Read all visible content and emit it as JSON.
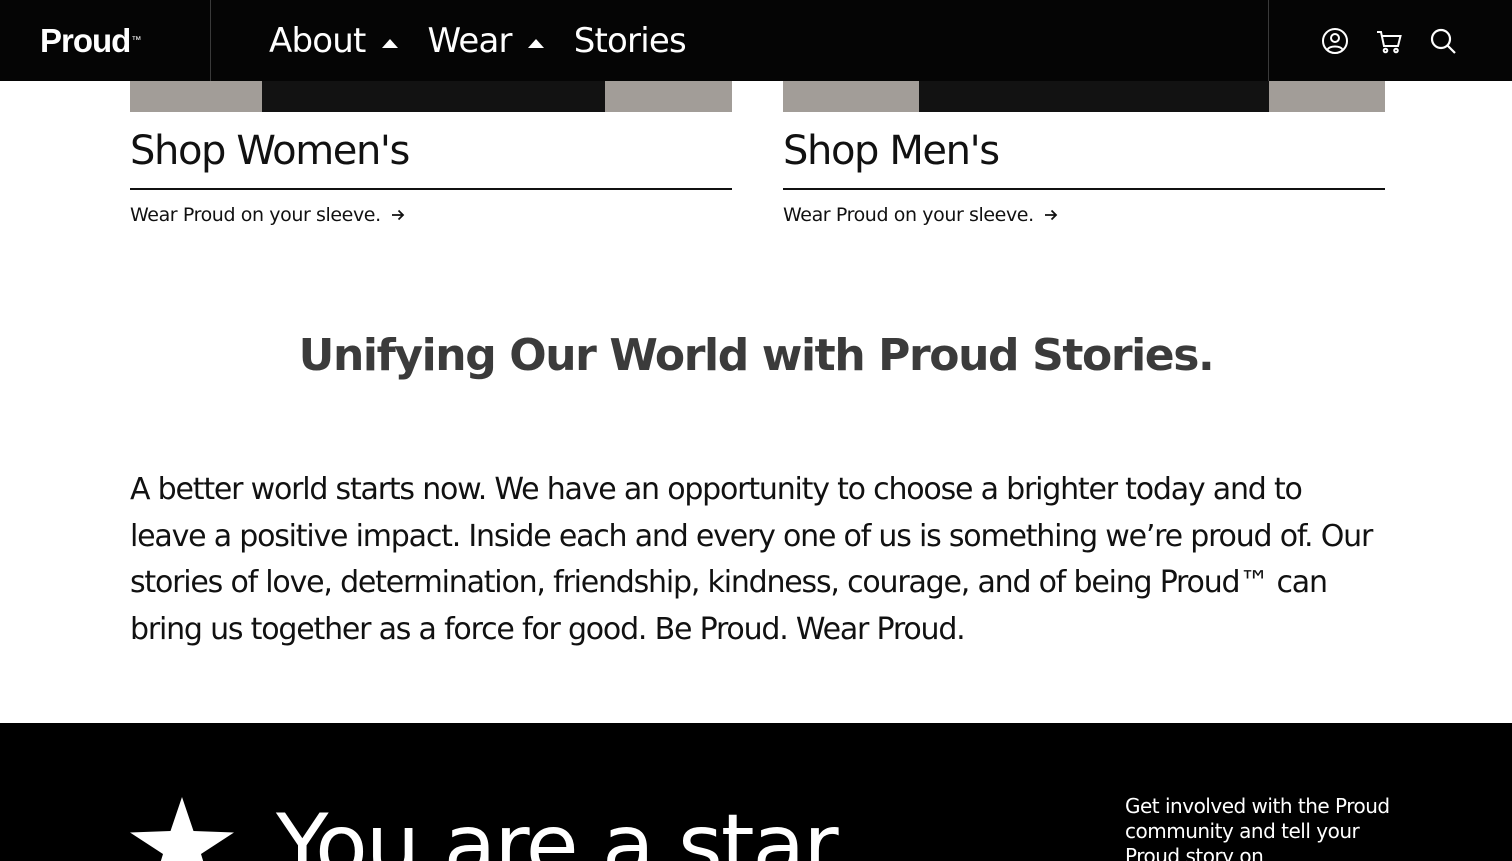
{
  "header": {
    "brand": "Proud",
    "brand_mark": "™",
    "nav": [
      {
        "label": "About",
        "has_caret": true
      },
      {
        "label": "Wear",
        "has_caret": true
      },
      {
        "label": "Stories",
        "has_caret": false
      }
    ],
    "icons": [
      "account-icon",
      "cart-icon",
      "search-icon"
    ]
  },
  "shop": {
    "women": {
      "title": "Shop Women's",
      "subtitle": "Wear Proud on your sleeve."
    },
    "men": {
      "title": "Shop Men's",
      "subtitle": "Wear Proud on your sleeve."
    }
  },
  "stories": {
    "heading": "Unifying Our World with Proud Stories.",
    "body": "A better world starts now. We have an opportunity to choose a brighter today and to leave a positive impact. Inside each and every one of us is something we’re proud of. Our stories of love, determination, friendship, kindness, courage, and of being Proud™ can bring us together as a force for good.  Be Proud. Wear Proud."
  },
  "star_banner": {
    "title": "You are a star",
    "blurb": "Get involved with the Proud community and tell your Proud story on"
  },
  "colors": {
    "nav_bg": "#050505",
    "banner_bg": "#000000",
    "text": "#111111",
    "heading": "#3b3b3b"
  }
}
